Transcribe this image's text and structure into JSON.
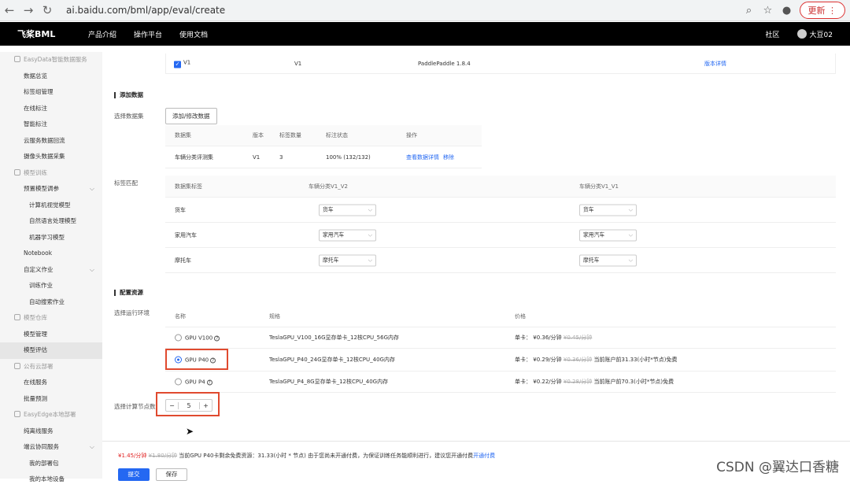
{
  "browser": {
    "url": "ai.baidu.com/bml/app/eval/create",
    "update_label": "更新"
  },
  "topbar": {
    "logo": "飞桨BML",
    "nav": [
      "产品介绍",
      "操作平台",
      "使用文档"
    ],
    "community": "社区",
    "user": "大豆02"
  },
  "sidebar": {
    "items": [
      {
        "label": "EasyData智能数据服务",
        "group": true
      },
      {
        "label": "数据总览"
      },
      {
        "label": "标签组管理"
      },
      {
        "label": "在线标注"
      },
      {
        "label": "智能标注"
      },
      {
        "label": "云服务数据回流"
      },
      {
        "label": "摄像头数据采集"
      },
      {
        "label": "模型训练",
        "group": true
      },
      {
        "label": "预置模型调参",
        "caret": true
      },
      {
        "label": "计算机视觉模型",
        "l2": true
      },
      {
        "label": "自然语言处理模型",
        "l2": true
      },
      {
        "label": "机器学习模型",
        "l2": true
      },
      {
        "label": "Notebook"
      },
      {
        "label": "自定义作业",
        "caret": true
      },
      {
        "label": "训练作业",
        "l2": true
      },
      {
        "label": "自动搜索作业",
        "l2": true
      },
      {
        "label": "模型仓库",
        "group": true
      },
      {
        "label": "模型管理"
      },
      {
        "label": "模型评估",
        "active": true
      },
      {
        "label": "公有云部署",
        "group": true
      },
      {
        "label": "在线服务"
      },
      {
        "label": "批量预测"
      },
      {
        "label": "EasyEdge本地部署",
        "group": true
      },
      {
        "label": "纯离线服务"
      },
      {
        "label": "端云协同服务",
        "caret": true
      },
      {
        "label": "我的部署包",
        "l2": true
      },
      {
        "label": "我的本地设备",
        "l2": true
      }
    ]
  },
  "version_row": {
    "name": "V1",
    "version": "V1",
    "framework": "PaddlePaddle 1.8.4",
    "link": "版本详情"
  },
  "add_data": {
    "section": "添加数据",
    "select_label": "选择数据集",
    "button": "添加/修改数据",
    "headers": [
      "数据集",
      "版本",
      "标签数量",
      "标注状态",
      "操作"
    ],
    "row": {
      "dataset": "车辆分类评测集",
      "version": "V1",
      "count": "3",
      "status": "100% (132/132)",
      "view": "查看数据详情",
      "remove": "移除"
    }
  },
  "label_match": {
    "label": "标签匹配",
    "headers": [
      "数据集标签",
      "车辆分类V1_V2",
      "车辆分类V1_V1"
    ],
    "rows": [
      {
        "tag": "货车",
        "a": "货车",
        "b": "货车"
      },
      {
        "tag": "家用汽车",
        "a": "家用汽车",
        "b": "家用汽车"
      },
      {
        "tag": "摩托车",
        "a": "摩托车",
        "b": "摩托车"
      }
    ]
  },
  "resources": {
    "section": "配置资源",
    "env_label": "选择运行环境",
    "headers": [
      "名称",
      "规格",
      "价格"
    ],
    "rows": [
      {
        "name": "GPU V100",
        "spec": "TeslaGPU_V100_16G显存单卡_12核CPU_56G内存",
        "unit": "单卡：",
        "price": "¥0.36/分钟",
        "old": "¥0.45/分钟",
        "note": "",
        "selected": false
      },
      {
        "name": "GPU P40",
        "spec": "TeslaGPU_P40_24G显存单卡_12核CPU_40G内存",
        "unit": "单卡：",
        "price": "¥0.29/分钟",
        "old": "¥0.36/分钟",
        "note": "当前账户前31.33(小时*节点)免费",
        "selected": true
      },
      {
        "name": "GPU P4",
        "spec": "TeslaGPU_P4_8G显存单卡_12核CPU_40G内存",
        "unit": "单卡：",
        "price": "¥0.22/分钟",
        "old": "¥0.28/分钟",
        "note": "当前账户前70.3(小时*节点)免费",
        "selected": false
      }
    ],
    "nodes_label": "选择计算节点数",
    "nodes": "5",
    "minus": "−",
    "plus": "+"
  },
  "footer": {
    "price": "¥1.45/分钟",
    "old_price": "¥1.80/分钟",
    "message": "当前GPU P40卡剩余免费资源：31.33(小时 * 节点) 由于您尚未开通付费，为保证训练任务能顺利进行，建议您开通付费",
    "link": "开通付费",
    "submit": "提交",
    "save": "保存"
  },
  "watermark": "CSDN @翼达口香糖"
}
